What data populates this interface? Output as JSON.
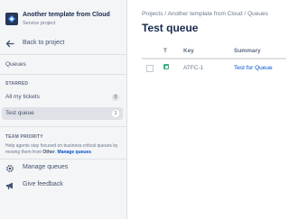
{
  "sidebar": {
    "project_name": "Another template from Cloud",
    "project_type": "Service project",
    "back_label": "Back to project",
    "queues_label": "Queues",
    "starred_heading": "STARRED",
    "items": [
      {
        "label": "All my tickets",
        "count": "0"
      },
      {
        "label": "Test queue",
        "count": "1"
      }
    ],
    "team_priority_heading": "TEAM PRIORITY",
    "priority_text_1": "Help agents stay focused on business-critical queues by moving them from ",
    "priority_text_other": "Other",
    "priority_text_2": ". ",
    "priority_link": "Manage queues",
    "manage_queues_label": "Manage queues",
    "feedback_label": "Give feedback"
  },
  "breadcrumb": [
    "Projects",
    "Another template from Cloud",
    "Queues"
  ],
  "breadcrumb_separator": "/",
  "page_title": "Test queue",
  "table": {
    "headers": {
      "type": "T",
      "key": "Key",
      "summary": "Summary"
    },
    "rows": [
      {
        "key": "ATFC-1",
        "summary": "Test for Queue"
      }
    ]
  },
  "icons": {
    "project_avatar": "project-avatar-icon",
    "back": "back-arrow-icon",
    "manage": "gear-icon",
    "feedback": "megaphone-icon",
    "issue_type": "task-type-icon"
  },
  "colors": {
    "sidebar_bg": "#f4f5f7",
    "active_item_bg": "#dfe1e6",
    "link": "#0052cc",
    "task_icon": "#36b37e",
    "avatar_bg": "#253858"
  }
}
